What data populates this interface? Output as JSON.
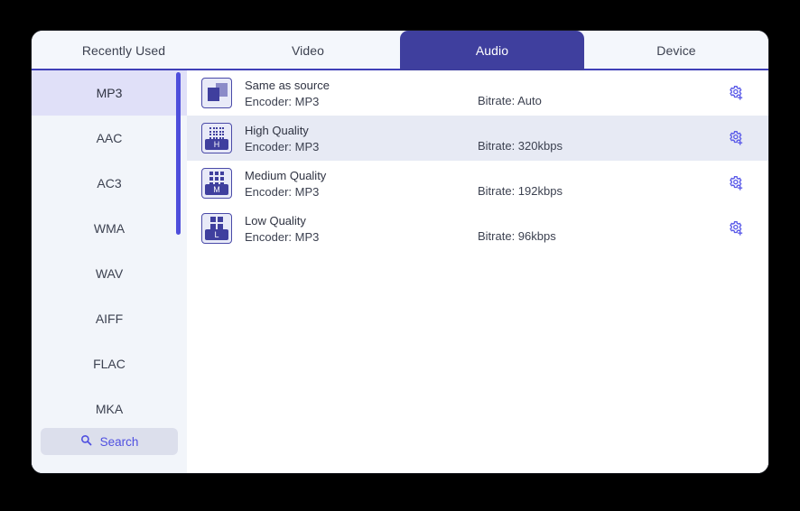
{
  "window": {
    "tabs": [
      {
        "label": "Recently Used",
        "active": false
      },
      {
        "label": "Video",
        "active": false
      },
      {
        "label": "Audio",
        "active": true
      },
      {
        "label": "Device",
        "active": false
      }
    ]
  },
  "sidebar": {
    "formats": [
      {
        "label": "MP3",
        "selected": true
      },
      {
        "label": "AAC",
        "selected": false
      },
      {
        "label": "AC3",
        "selected": false
      },
      {
        "label": "WMA",
        "selected": false
      },
      {
        "label": "WAV",
        "selected": false
      },
      {
        "label": "AIFF",
        "selected": false
      },
      {
        "label": "FLAC",
        "selected": false
      },
      {
        "label": "MKA",
        "selected": false
      }
    ],
    "search_label": "Search",
    "search_icon": "search-icon",
    "scrollbar": {
      "color": "#4e4edb"
    }
  },
  "presets": [
    {
      "title": "Same as source",
      "encoder": "Encoder: MP3",
      "bitrate": "Bitrate: Auto",
      "icon": "same-as-source-icon",
      "gear_icon": "gear-plus-icon",
      "selected": false
    },
    {
      "title": "High Quality",
      "encoder": "Encoder: MP3",
      "bitrate": "Bitrate: 320kbps",
      "icon": "high-quality-icon",
      "icon_letter": "H",
      "gear_icon": "gear-plus-icon",
      "selected": true
    },
    {
      "title": "Medium Quality",
      "encoder": "Encoder: MP3",
      "bitrate": "Bitrate: 192kbps",
      "icon": "medium-quality-icon",
      "icon_letter": "M",
      "gear_icon": "gear-plus-icon",
      "selected": false
    },
    {
      "title": "Low Quality",
      "encoder": "Encoder: MP3",
      "bitrate": "Bitrate: 96kbps",
      "icon": "low-quality-icon",
      "icon_letter": "L",
      "gear_icon": "gear-plus-icon",
      "selected": false
    }
  ],
  "colors": {
    "accent": "#3f3f9e",
    "accent_light": "#5050e0",
    "tab_active_bg": "#3f3f9e",
    "sidebar_bg": "#f2f5fa",
    "sidebar_selected_bg": "#e0e0f8",
    "row_selected_bg": "#e7eaf4",
    "tabbar_bg": "#f4f7fc"
  }
}
